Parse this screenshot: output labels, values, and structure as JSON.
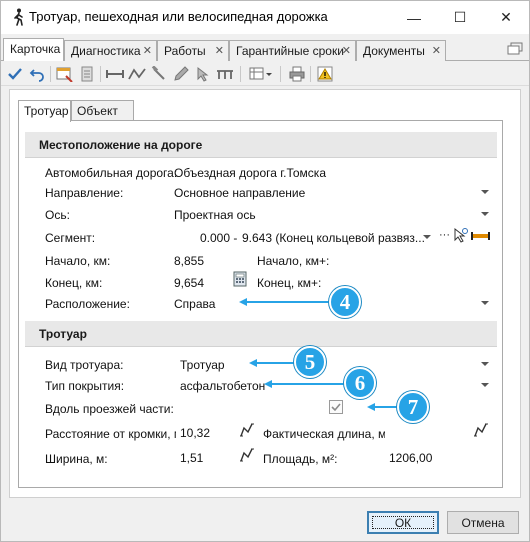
{
  "window": {
    "title": "Тротуар, пешеходная или велосипедная дорожка",
    "minimize_glyph": "—",
    "maximize_glyph": "☐",
    "close_glyph": "✕"
  },
  "doc_tabs": [
    {
      "label": "Карточка",
      "closable": false
    },
    {
      "label": "Диагностика",
      "closable": true
    },
    {
      "label": "Работы",
      "closable": true
    },
    {
      "label": "Гарантийные сроки",
      "closable": true
    },
    {
      "label": "Документы",
      "closable": true
    }
  ],
  "tab_close_glyph": "✕",
  "inner_tabs": [
    "Тротуар",
    "Объект"
  ],
  "location": {
    "heading": "Местоположение на дороге",
    "road_label": "Автомобильная дорога:",
    "road_value": "Объездная дорога г.Томска",
    "direction_label": "Направление:",
    "direction_value": "Основное направление",
    "axis_label": "Ось:",
    "axis_value": "Проектная ось",
    "segment_label": "Сегмент:",
    "segment_start": "0.000 -",
    "segment_value": "9.643 (Конец кольцевой развяз...",
    "segment_dots": "···",
    "start_label": "Начало, км:",
    "start_value": "8,855",
    "start_kmplus_label": "Начало, км+:",
    "end_label": "Конец, км:",
    "end_value": "9,654",
    "end_kmplus_label": "Конец, км+:",
    "position_label": "Расположение:",
    "position_value": "Справа"
  },
  "sidewalk": {
    "heading": "Тротуар",
    "kind_label": "Вид тротуара:",
    "kind_value": "Тротуар",
    "surface_label": "Тип покрытия:",
    "surface_value": "асфальтобетон",
    "along_label": "Вдоль проезжей части:",
    "along_checked": true,
    "distance_label": "Расстояние от кромки, м:",
    "distance_value": "10,32",
    "actual_length_label": "Фактическая длина, м:",
    "actual_length_value": "",
    "width_label": "Ширина, м:",
    "width_value": "1,51",
    "area_label": "Площадь, м²:",
    "area_value": "1206,00"
  },
  "callouts": [
    "4",
    "5",
    "6",
    "7"
  ],
  "buttons": {
    "ok": "ОК",
    "cancel": "Отмена"
  },
  "colors": {
    "callout": "#27a3e6",
    "section_bg": "#e8e8e8",
    "accent_blue": "#2f6fb6"
  }
}
